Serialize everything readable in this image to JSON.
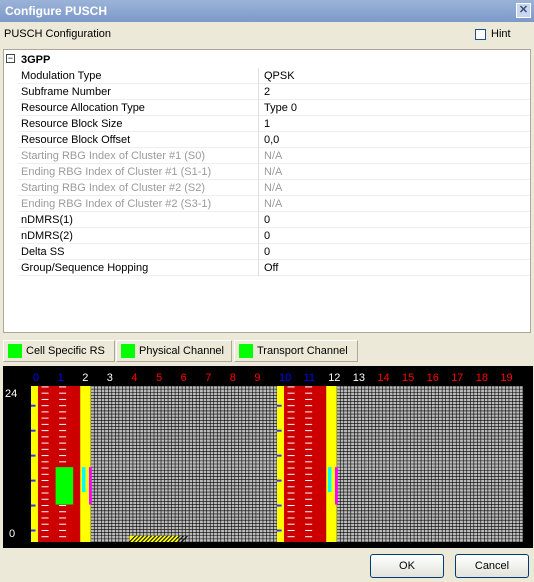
{
  "window": {
    "title": "Configure PUSCH",
    "close_glyph": "✕"
  },
  "header": {
    "label": "PUSCH Configuration",
    "hint_label": "Hint"
  },
  "group": {
    "title": "3GPP",
    "toggle_glyph": "−"
  },
  "properties": [
    {
      "key": "Modulation Type",
      "value": "QPSK",
      "enabled": true
    },
    {
      "key": "Subframe Number",
      "value": "2",
      "enabled": true
    },
    {
      "key": "Resource Allocation Type",
      "value": "Type 0",
      "enabled": true
    },
    {
      "key": "Resource Block Size",
      "value": "1",
      "enabled": true
    },
    {
      "key": "Resource Block Offset",
      "value": "0,0",
      "enabled": true
    },
    {
      "key": "Starting RBG Index of Cluster #1 (S0)",
      "value": "N/A",
      "enabled": false
    },
    {
      "key": "Ending RBG Index of Cluster #1 (S1-1)",
      "value": "N/A",
      "enabled": false
    },
    {
      "key": "Starting RBG Index of Cluster #2 (S2)",
      "value": "N/A",
      "enabled": false
    },
    {
      "key": "Ending RBG Index of Cluster #2 (S3-1)",
      "value": "N/A",
      "enabled": false
    },
    {
      "key": "nDMRS(1)",
      "value": "0",
      "enabled": true
    },
    {
      "key": "nDMRS(2)",
      "value": "0",
      "enabled": true
    },
    {
      "key": "Delta SS",
      "value": "0",
      "enabled": true
    },
    {
      "key": "Group/Sequence Hopping",
      "value": "Off",
      "enabled": true
    }
  ],
  "legend": [
    {
      "label": "Cell Specific RS",
      "color": "#00ff00"
    },
    {
      "label": "Physical Channel",
      "color": "#00ff00"
    },
    {
      "label": "Transport Channel",
      "color": "#00ff00"
    }
  ],
  "grid": {
    "slots": [
      "0",
      "1",
      "2",
      "3",
      "4",
      "5",
      "6",
      "7",
      "8",
      "9",
      "10",
      "11",
      "12",
      "13",
      "14",
      "15",
      "16",
      "17",
      "18",
      "19"
    ],
    "slot_colors": [
      "#0000ff",
      "#0000ff",
      "#ffffff",
      "#ffffff",
      "#ff0000",
      "#ff0000",
      "#ff0000",
      "#ff0000",
      "#ff0000",
      "#ff0000",
      "#0000ff",
      "#0000ff",
      "#ffffff",
      "#ffffff",
      "#ff0000",
      "#ff0000",
      "#ff0000",
      "#ff0000",
      "#ff0000",
      "#ff0000"
    ],
    "y_top_label": "24",
    "y_bottom_label": "0",
    "background": "#000000",
    "cell_color": "#ffffff",
    "rs_color": "#ffff00",
    "channel_color": "#cc0000",
    "highlight_color": "#00ff00",
    "marker_color": "#ff00ff",
    "accent_color": "#00ffff"
  },
  "buttons": {
    "ok": "OK",
    "cancel": "Cancel"
  }
}
